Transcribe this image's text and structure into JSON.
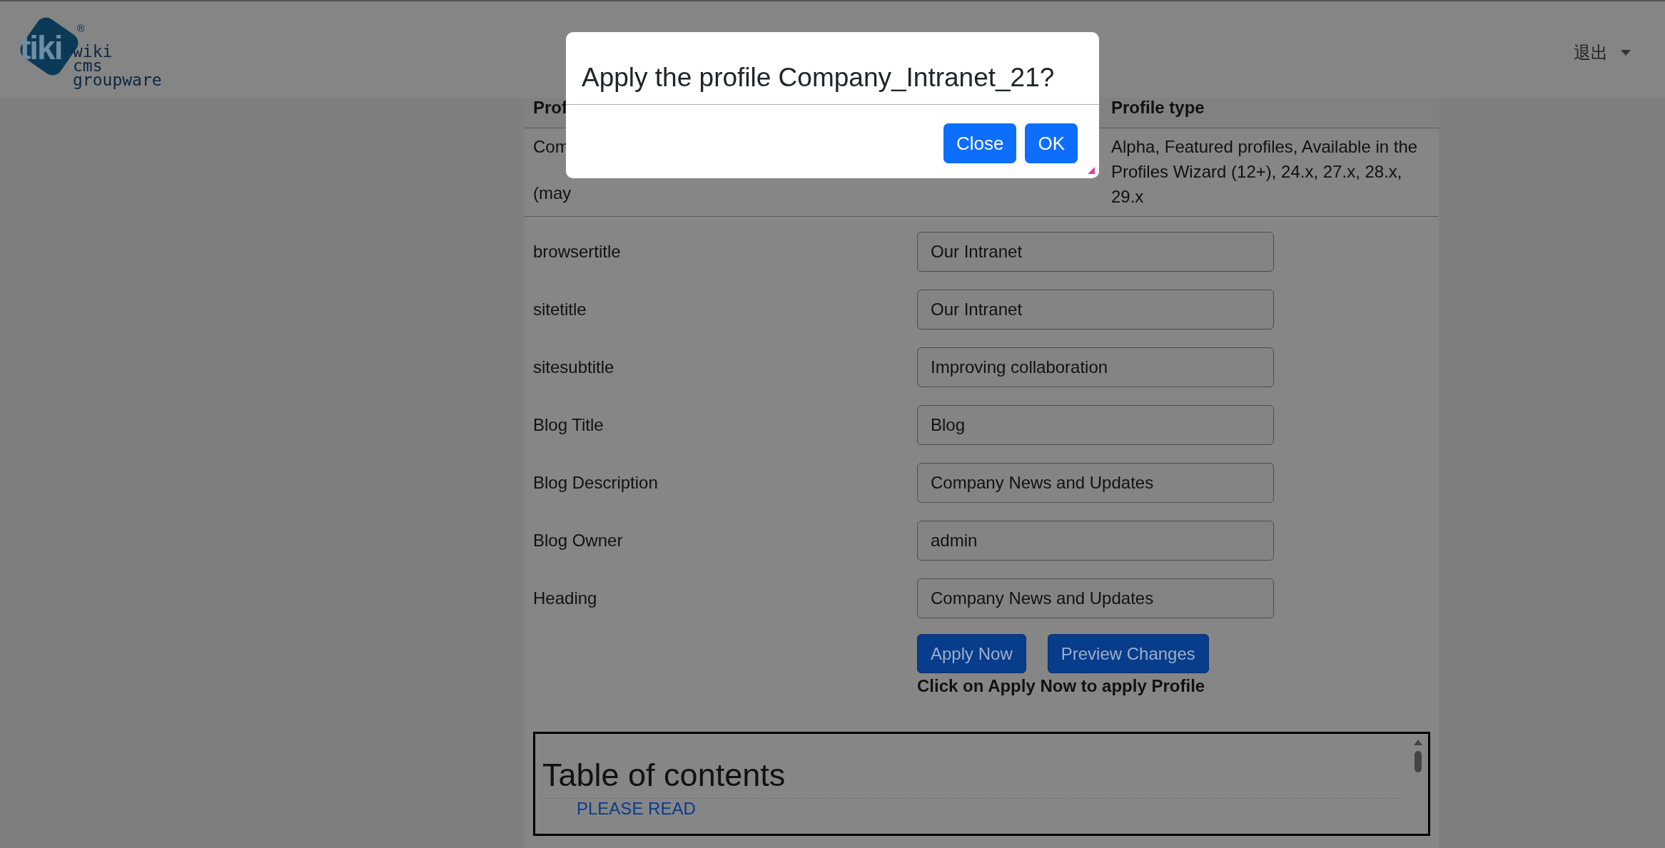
{
  "header": {
    "logo": {
      "mark": "tiki",
      "registered": "®",
      "lines": [
        "wiki",
        "cms",
        "groupware"
      ]
    },
    "user_menu": {
      "label": "退出"
    }
  },
  "profile_table": {
    "columns": [
      "Prof",
      "Profile type"
    ],
    "row": {
      "column_1_lines": [
        "Com",
        "(may"
      ],
      "profile_type": "Alpha, Featured profiles, Available in the Profiles Wizard (12+), 24.x, 27.x, 28.x, 29.x"
    }
  },
  "parameters": [
    {
      "label": "browsertitle",
      "value": "Our Intranet"
    },
    {
      "label": "sitetitle",
      "value": "Our Intranet"
    },
    {
      "label": "sitesubtitle",
      "value": "Improving collaboration"
    },
    {
      "label": "Blog Title",
      "value": "Blog"
    },
    {
      "label": "Blog Description",
      "value": "Company News and Updates"
    },
    {
      "label": "Blog Owner",
      "value": "admin"
    },
    {
      "label": "Heading",
      "value": "Company News and Updates"
    }
  ],
  "actions": {
    "buttons": [
      "Apply Now",
      "Preview Changes"
    ],
    "note": "Click on Apply Now to apply Profile"
  },
  "toc": {
    "title": "Table of contents",
    "items": [
      {
        "label": "PLEASE READ"
      }
    ]
  },
  "modal": {
    "title": "Apply the profile Company_Intranet_21?",
    "buttons": [
      "Close",
      "OK"
    ]
  }
}
